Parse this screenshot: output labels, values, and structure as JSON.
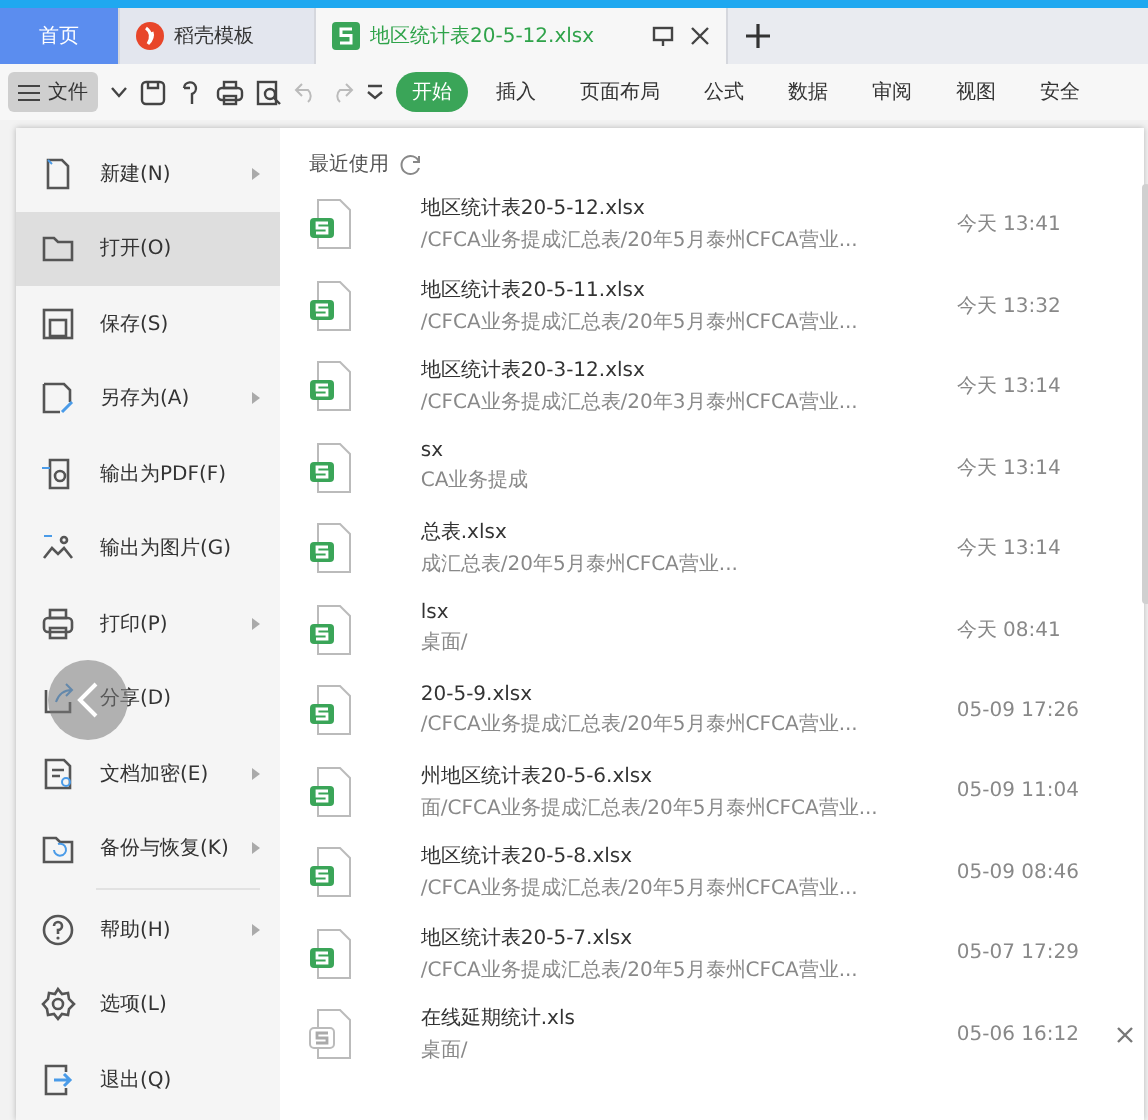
{
  "tabs": [
    {
      "label": "首页",
      "kind": "home",
      "selected": false
    },
    {
      "label": "稻壳模板",
      "kind": "docer",
      "selected": false
    },
    {
      "label": "地区统计表20-5-12.xlsx",
      "kind": "sheet",
      "selected": true
    }
  ],
  "toolbar": {
    "file_menu": "文件",
    "ribbon_tabs": [
      {
        "label": "开始",
        "selected": true
      },
      {
        "label": "插入",
        "selected": false
      },
      {
        "label": "页面布局",
        "selected": false
      },
      {
        "label": "公式",
        "selected": false
      },
      {
        "label": "数据",
        "selected": false
      },
      {
        "label": "审阅",
        "selected": false
      },
      {
        "label": "视图",
        "selected": false
      },
      {
        "label": "安全",
        "selected": false
      }
    ]
  },
  "menu": [
    {
      "label": "新建(N)",
      "submenu": true,
      "selected": false
    },
    {
      "label": "打开(O)",
      "submenu": false,
      "selected": true
    },
    {
      "label": "保存(S)",
      "submenu": false,
      "selected": false
    },
    {
      "label": "另存为(A)",
      "submenu": true,
      "selected": false
    },
    {
      "label": "输出为PDF(F)",
      "submenu": false,
      "selected": false
    },
    {
      "label": "输出为图片(G)",
      "submenu": false,
      "selected": false
    },
    {
      "label": "打印(P)",
      "submenu": true,
      "selected": false
    },
    {
      "label": "分享(D)",
      "submenu": false,
      "selected": false
    },
    {
      "label": "文档加密(E)",
      "submenu": true,
      "selected": false
    },
    {
      "label": "备份与恢复(K)",
      "submenu": true,
      "selected": false
    },
    {
      "label": "帮助(H)",
      "submenu": true,
      "selected": false,
      "divider_before": true
    },
    {
      "label": "选项(L)",
      "submenu": false,
      "selected": false
    },
    {
      "label": "退出(Q)",
      "submenu": false,
      "selected": false
    }
  ],
  "recent": {
    "title": "最近使用",
    "files": [
      {
        "name": "地区统计表20-5-12.xlsx",
        "path": "/CFCA业务提成汇总表/20年5月泰州CFCA营业...",
        "time": "今天 13:41",
        "kind": "sheet",
        "hovered": false
      },
      {
        "name": "地区统计表20-5-11.xlsx",
        "path": "/CFCA业务提成汇总表/20年5月泰州CFCA营业...",
        "time": "今天 13:32",
        "kind": "sheet",
        "hovered": false
      },
      {
        "name": "地区统计表20-3-12.xlsx",
        "path": "/CFCA业务提成汇总表/20年3月泰州CFCA营业...",
        "time": "今天 13:14",
        "kind": "sheet",
        "hovered": false
      },
      {
        "name": "sx",
        "path": "CA业务提成",
        "time": "今天 13:14",
        "kind": "sheet",
        "hovered": false
      },
      {
        "name": "总表.xlsx",
        "path": "成汇总表/20年5月泰州CFCA营业...",
        "time": "今天 13:14",
        "kind": "sheet",
        "hovered": false
      },
      {
        "name": "lsx",
        "path": "桌面/",
        "time": "今天 08:41",
        "kind": "sheet",
        "hovered": false
      },
      {
        "name": "20-5-9.xlsx",
        "path": "/CFCA业务提成汇总表/20年5月泰州CFCA营业...",
        "time": "05-09 17:26",
        "kind": "sheet",
        "hovered": false
      },
      {
        "name": "州地区统计表20-5-6.xlsx",
        "path": "面/CFCA业务提成汇总表/20年5月泰州CFCA营业...",
        "time": "05-09 11:04",
        "kind": "sheet",
        "hovered": false
      },
      {
        "name": "地区统计表20-5-8.xlsx",
        "path": "/CFCA业务提成汇总表/20年5月泰州CFCA营业...",
        "time": "05-09 08:46",
        "kind": "sheet",
        "hovered": false
      },
      {
        "name": "地区统计表20-5-7.xlsx",
        "path": "/CFCA业务提成汇总表/20年5月泰州CFCA营业...",
        "time": "05-07 17:29",
        "kind": "sheet",
        "hovered": false
      },
      {
        "name": "在线延期统计.xls",
        "path": "桌面/",
        "time": "05-06 16:12",
        "kind": "old",
        "hovered": true
      }
    ]
  }
}
